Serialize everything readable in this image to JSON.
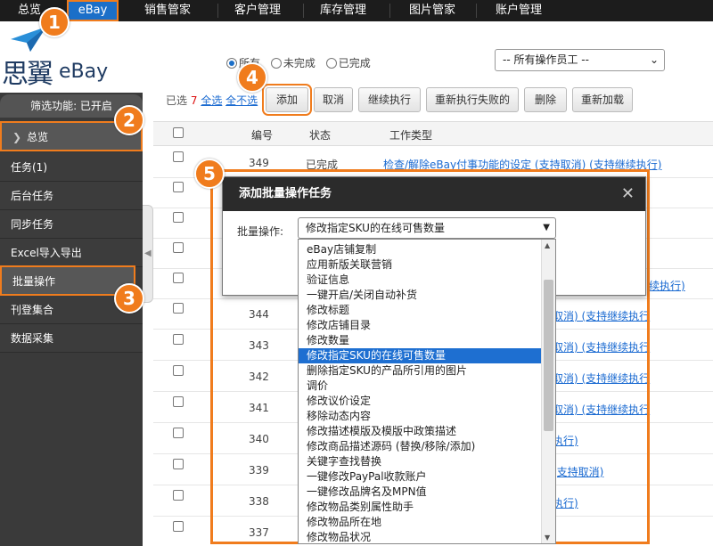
{
  "topnav": {
    "items": [
      "总览",
      "eBay",
      "销售管家",
      "客户管理",
      "库存管理",
      "图片管家",
      "账户管理"
    ],
    "active_index": 1
  },
  "logo": {
    "cn": "思翼",
    "en": "eBay"
  },
  "sidebar": {
    "filter_status": "筛选功能: 已开启",
    "items": [
      "总览",
      "任务(1)",
      "后台任务",
      "同步任务",
      "Excel导入导出",
      "批量操作",
      "刊登集合",
      "数据采集"
    ]
  },
  "filters": {
    "radios": [
      "所有",
      "未完成",
      "已完成"
    ],
    "selected_radio": 0,
    "operator_select": "-- 所有操作员工 --"
  },
  "toolbar": {
    "selected_prefix": "已选",
    "selected_count": "7",
    "select_all": "全选",
    "select_none": "全不选",
    "buttons": [
      "添加",
      "取消",
      "继续执行",
      "重新执行失败的",
      "删除",
      "重新加载"
    ]
  },
  "table": {
    "headers": [
      "编号",
      "状态",
      "工作类型"
    ],
    "rows": [
      {
        "id": "349",
        "status": "已完成",
        "type": "检查/解除eBay付事功能的设定 (支持取消) (支持继续执行)"
      },
      {
        "id": "",
        "status": "",
        "type": ""
      },
      {
        "id": "",
        "status": "",
        "type": ""
      },
      {
        "id": "",
        "status": "",
        "type": ""
      },
      {
        "id": "",
        "status": "",
        "type": "续执行)"
      },
      {
        "id": "344",
        "status": "",
        "type": "取消) (支持继续执行"
      },
      {
        "id": "343",
        "status": "",
        "type": "取消) (支持继续执行"
      },
      {
        "id": "342",
        "status": "",
        "type": "取消) (支持继续执行"
      },
      {
        "id": "341",
        "status": "",
        "type": "取消) (支持继续执行"
      },
      {
        "id": "340",
        "status": "",
        "type": "执行)"
      },
      {
        "id": "339",
        "status": "",
        "type": "(支持取消)"
      },
      {
        "id": "338",
        "status": "",
        "type": "执行)"
      },
      {
        "id": "337",
        "status": "",
        "type": ""
      }
    ]
  },
  "dialog": {
    "title": "添加批量操作任务",
    "close": "✕",
    "label": "批量操作:",
    "selected_value": "修改指定SKU的在线可售数量"
  },
  "dropdown": {
    "options": [
      "eBay店铺复制",
      "应用新版关联营销",
      "验证信息",
      "一键开启/关闭自动补货",
      "修改标题",
      "修改店铺目录",
      "修改数量",
      "修改指定SKU的在线可售数量",
      "删除指定SKU的产品所引用的图片",
      "调价",
      "修改议价设定",
      "移除动态内容",
      "修改描述模版及模版中政策描述",
      "修改商品描述源码 (替换/移除/添加)",
      "关键字查找替换",
      "一键修改PayPal收款账户",
      "一键修改品牌名及MPN值",
      "修改物品类别属性助手",
      "修改物品所在地",
      "修改物品状况"
    ],
    "selected_index": 7
  },
  "annotations": [
    "1",
    "2",
    "3",
    "4",
    "5"
  ],
  "colors": {
    "accent": "#f07c1d",
    "nav_active": "#1b6fc8",
    "selection": "#1e6fd1"
  }
}
